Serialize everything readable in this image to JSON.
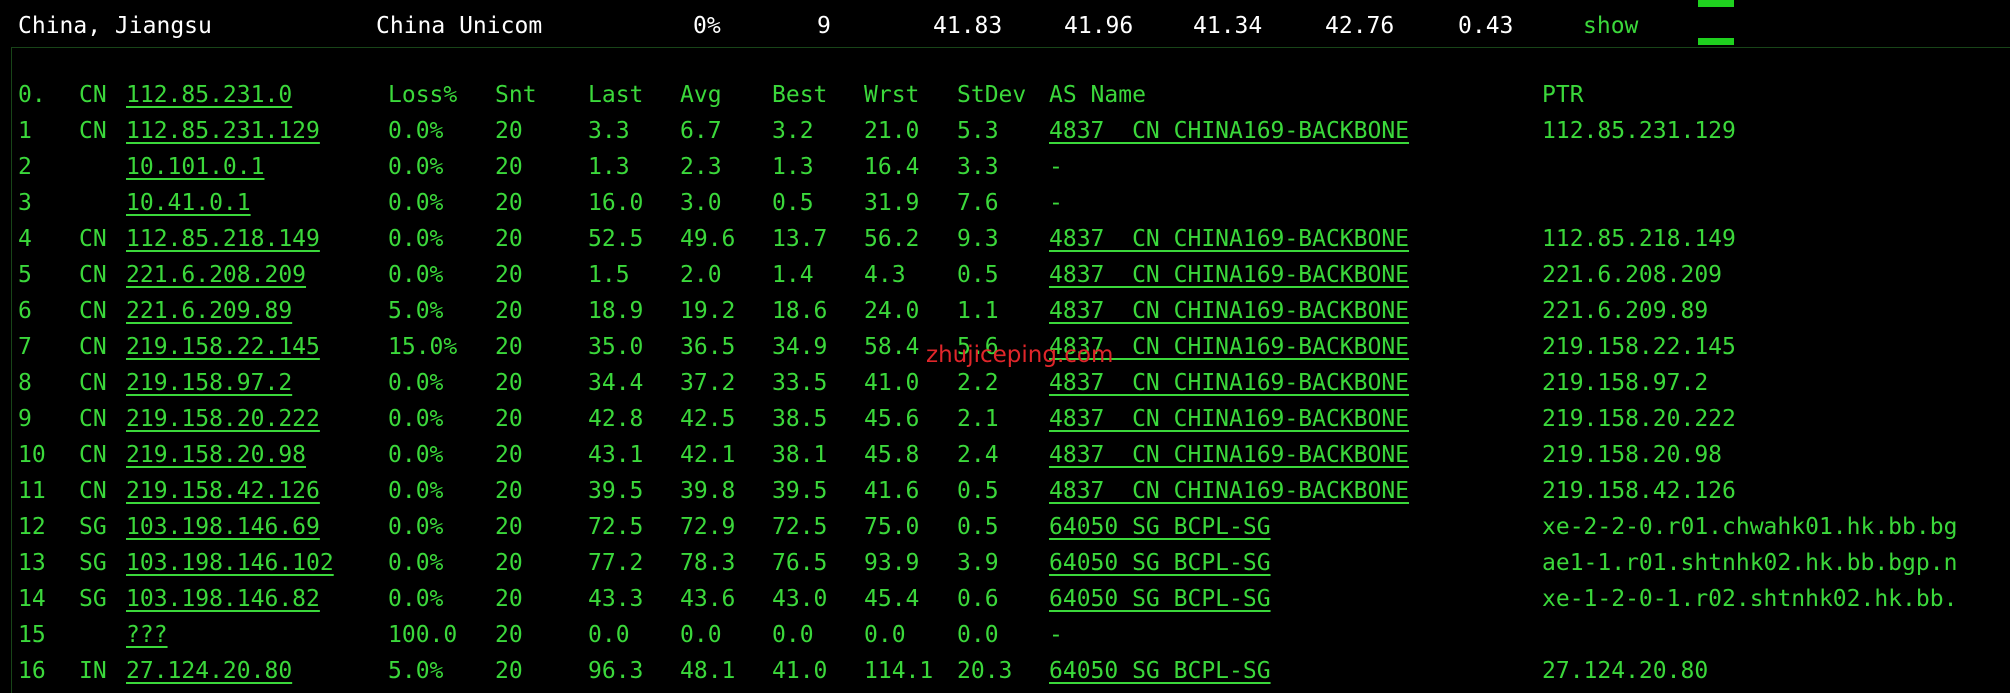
{
  "summary": {
    "location": "China, Jiangsu",
    "isp": "China Unicom",
    "loss": "0%",
    "sent": "9",
    "last": "41.83",
    "avg": "41.96",
    "best": "41.34",
    "worst": "42.76",
    "stdev": "0.43",
    "action_label": "show"
  },
  "header": {
    "index": "0.",
    "cc": "CN",
    "host": "112.85.231.0",
    "loss": "Loss%",
    "snt": "Snt",
    "last": "Last",
    "avg": "Avg",
    "best": "Best",
    "wrst": "Wrst",
    "stdev": "StDev",
    "as_name": "AS Name",
    "ptr": "PTR"
  },
  "hops": [
    {
      "index": "1",
      "cc": "CN",
      "host": "112.85.231.129",
      "loss": "0.0%",
      "snt": "20",
      "last": "3.3",
      "avg": "6.7",
      "best": "3.2",
      "wrst": "21.0",
      "stdev": "5.3",
      "as_name": "4837  CN CHINA169-BACKBONE",
      "ptr": "112.85.231.129"
    },
    {
      "index": "2",
      "cc": "",
      "host": "10.101.0.1",
      "loss": "0.0%",
      "snt": "20",
      "last": "1.3",
      "avg": "2.3",
      "best": "1.3",
      "wrst": "16.4",
      "stdev": "3.3",
      "as_name": "-",
      "ptr": ""
    },
    {
      "index": "3",
      "cc": "",
      "host": "10.41.0.1",
      "loss": "0.0%",
      "snt": "20",
      "last": "16.0",
      "avg": "3.0",
      "best": "0.5",
      "wrst": "31.9",
      "stdev": "7.6",
      "as_name": "-",
      "ptr": ""
    },
    {
      "index": "4",
      "cc": "CN",
      "host": "112.85.218.149",
      "loss": "0.0%",
      "snt": "20",
      "last": "52.5",
      "avg": "49.6",
      "best": "13.7",
      "wrst": "56.2",
      "stdev": "9.3",
      "as_name": "4837  CN CHINA169-BACKBONE",
      "ptr": "112.85.218.149"
    },
    {
      "index": "5",
      "cc": "CN",
      "host": "221.6.208.209",
      "loss": "0.0%",
      "snt": "20",
      "last": "1.5",
      "avg": "2.0",
      "best": "1.4",
      "wrst": "4.3",
      "stdev": "0.5",
      "as_name": "4837  CN CHINA169-BACKBONE",
      "ptr": "221.6.208.209"
    },
    {
      "index": "6",
      "cc": "CN",
      "host": "221.6.209.89",
      "loss": "5.0%",
      "snt": "20",
      "last": "18.9",
      "avg": "19.2",
      "best": "18.6",
      "wrst": "24.0",
      "stdev": "1.1",
      "as_name": "4837  CN CHINA169-BACKBONE",
      "ptr": "221.6.209.89"
    },
    {
      "index": "7",
      "cc": "CN",
      "host": "219.158.22.145",
      "loss": "15.0%",
      "snt": "20",
      "last": "35.0",
      "avg": "36.5",
      "best": "34.9",
      "wrst": "58.4",
      "stdev": "5.6",
      "as_name": "4837  CN CHINA169-BACKBONE",
      "ptr": "219.158.22.145"
    },
    {
      "index": "8",
      "cc": "CN",
      "host": "219.158.97.2",
      "loss": "0.0%",
      "snt": "20",
      "last": "34.4",
      "avg": "37.2",
      "best": "33.5",
      "wrst": "41.0",
      "stdev": "2.2",
      "as_name": "4837  CN CHINA169-BACKBONE",
      "ptr": "219.158.97.2"
    },
    {
      "index": "9",
      "cc": "CN",
      "host": "219.158.20.222",
      "loss": "0.0%",
      "snt": "20",
      "last": "42.8",
      "avg": "42.5",
      "best": "38.5",
      "wrst": "45.6",
      "stdev": "2.1",
      "as_name": "4837  CN CHINA169-BACKBONE",
      "ptr": "219.158.20.222"
    },
    {
      "index": "10",
      "cc": "CN",
      "host": "219.158.20.98",
      "loss": "0.0%",
      "snt": "20",
      "last": "43.1",
      "avg": "42.1",
      "best": "38.1",
      "wrst": "45.8",
      "stdev": "2.4",
      "as_name": "4837  CN CHINA169-BACKBONE",
      "ptr": "219.158.20.98"
    },
    {
      "index": "11",
      "cc": "CN",
      "host": "219.158.42.126",
      "loss": "0.0%",
      "snt": "20",
      "last": "39.5",
      "avg": "39.8",
      "best": "39.5",
      "wrst": "41.6",
      "stdev": "0.5",
      "as_name": "4837  CN CHINA169-BACKBONE",
      "ptr": "219.158.42.126"
    },
    {
      "index": "12",
      "cc": "SG",
      "host": "103.198.146.69",
      "loss": "0.0%",
      "snt": "20",
      "last": "72.5",
      "avg": "72.9",
      "best": "72.5",
      "wrst": "75.0",
      "stdev": "0.5",
      "as_name": "64050 SG BCPL-SG",
      "ptr": "xe-2-2-0.r01.chwahk01.hk.bb.bg"
    },
    {
      "index": "13",
      "cc": "SG",
      "host": "103.198.146.102",
      "loss": "0.0%",
      "snt": "20",
      "last": "77.2",
      "avg": "78.3",
      "best": "76.5",
      "wrst": "93.9",
      "stdev": "3.9",
      "as_name": "64050 SG BCPL-SG",
      "ptr": "ae1-1.r01.shtnhk02.hk.bb.bgp.n"
    },
    {
      "index": "14",
      "cc": "SG",
      "host": "103.198.146.82",
      "loss": "0.0%",
      "snt": "20",
      "last": "43.3",
      "avg": "43.6",
      "best": "43.0",
      "wrst": "45.4",
      "stdev": "0.6",
      "as_name": "64050 SG BCPL-SG",
      "ptr": "xe-1-2-0-1.r02.shtnhk02.hk.bb."
    },
    {
      "index": "15",
      "cc": "",
      "host": "???",
      "loss": "100.0",
      "snt": "20",
      "last": "0.0",
      "avg": "0.0",
      "best": "0.0",
      "wrst": "0.0",
      "stdev": "0.0",
      "as_name": "-",
      "ptr": ""
    },
    {
      "index": "16",
      "cc": "IN",
      "host": "27.124.20.80",
      "loss": "5.0%",
      "snt": "20",
      "last": "96.3",
      "avg": "48.1",
      "best": "41.0",
      "wrst": "114.1",
      "stdev": "20.3",
      "as_name": "64050 SG BCPL-SG",
      "ptr": "27.124.20.80"
    }
  ],
  "watermark": "zhujiceping.com",
  "colors": {
    "text_green": "#3bd83b",
    "summary_white": "#ffffff",
    "bar_green": "#1fd11f",
    "watermark_red": "#e0262a"
  }
}
